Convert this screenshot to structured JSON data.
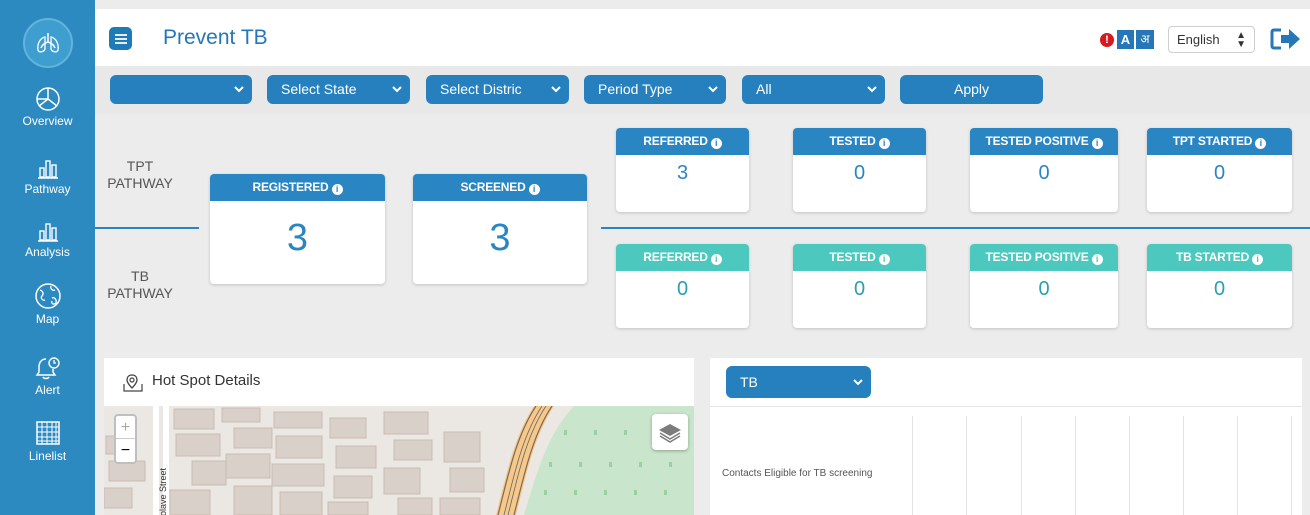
{
  "app": {
    "title": "Prevent TB"
  },
  "sidebar": {
    "items": [
      {
        "label": "Overview",
        "icon": "pie-chart-icon"
      },
      {
        "label": "Pathway",
        "icon": "bar-chart-icon"
      },
      {
        "label": "Analysis",
        "icon": "bar-chart-icon"
      },
      {
        "label": "Map",
        "icon": "globe-icon"
      },
      {
        "label": "Alert",
        "icon": "bell-icon"
      },
      {
        "label": "Linelist",
        "icon": "grid-icon"
      }
    ]
  },
  "header": {
    "alert_badge": "!",
    "lang_a": "A",
    "lang_b": "अ",
    "language": "English",
    "logout_icon": "logout-icon"
  },
  "filters": {
    "first": "",
    "state": "Select State",
    "district": "Select Distric",
    "period_type": "Period Type",
    "period": "All",
    "apply": "Apply"
  },
  "pathway": {
    "tpt_label_1": "TPT",
    "tpt_label_2": "PATHWAY",
    "tb_label_1": "TB",
    "tb_label_2": "PATHWAY",
    "registered": {
      "label": "REGISTERED",
      "value": "3"
    },
    "screened": {
      "label": "SCREENED",
      "value": "3"
    },
    "tpt": [
      {
        "label": "REFERRED",
        "value": "3"
      },
      {
        "label": "TESTED",
        "value": "0"
      },
      {
        "label": "TESTED POSITIVE",
        "value": "0"
      },
      {
        "label": "TPT STARTED",
        "value": "0"
      }
    ],
    "tb": [
      {
        "label": "REFERRED",
        "value": "0"
      },
      {
        "label": "TESTED",
        "value": "0"
      },
      {
        "label": "TESTED POSITIVE",
        "value": "0"
      },
      {
        "label": "TB STARTED",
        "value": "0"
      }
    ],
    "colors": {
      "tpt": "#2a86c3",
      "tb": "#4dc8be"
    }
  },
  "hotspot": {
    "title": "Hot Spot Details",
    "zoom_in": "+",
    "zoom_out": "−",
    "street_label": "olave Street"
  },
  "chart_panel": {
    "selected": "TB",
    "row_label": "Contacts Eligible for TB screening"
  }
}
